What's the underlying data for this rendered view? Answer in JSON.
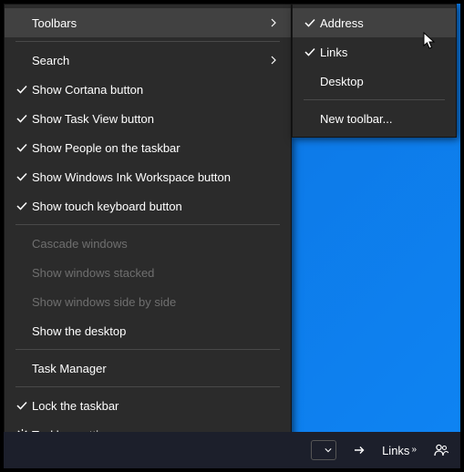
{
  "main_menu": {
    "toolbars": "Toolbars",
    "search": "Search",
    "show_cortana": "Show Cortana button",
    "show_taskview": "Show Task View button",
    "show_people": "Show People on the taskbar",
    "show_ink": "Show Windows Ink Workspace button",
    "show_touch_kb": "Show touch keyboard button",
    "cascade": "Cascade windows",
    "stacked": "Show windows stacked",
    "side_by_side": "Show windows side by side",
    "show_desktop": "Show the desktop",
    "task_manager": "Task Manager",
    "lock_taskbar": "Lock the taskbar",
    "taskbar_settings": "Taskbar settings"
  },
  "sub_menu": {
    "address": "Address",
    "links": "Links",
    "desktop": "Desktop",
    "new_toolbar": "New toolbar..."
  },
  "taskbar": {
    "links_label": "Links"
  }
}
